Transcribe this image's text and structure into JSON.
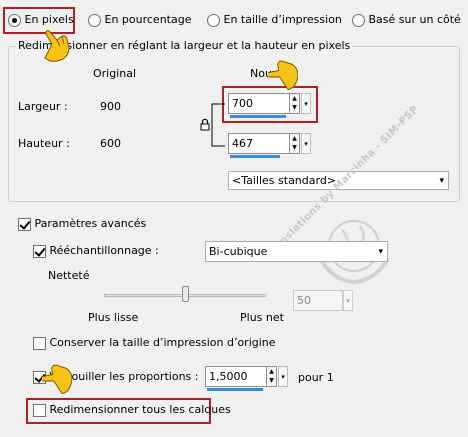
{
  "mode_options": [
    {
      "label": "En pixels",
      "checked": true
    },
    {
      "label": "En pourcentage",
      "checked": false
    },
    {
      "label": "En taille d’impression",
      "checked": false
    },
    {
      "label": "Basé sur un côté",
      "checked": false
    }
  ],
  "group": {
    "title": "Redimensionner en réglant la largeur et la hauteur en pixels",
    "col_original": "Original",
    "col_new": "Nouveau",
    "width_label": "Largeur :",
    "width_original": "900",
    "width_new": "700",
    "height_label": "Hauteur :",
    "height_original": "600",
    "height_new": "467",
    "standard_sizes": "<Tailles standard>"
  },
  "advanced": {
    "label": "Paramètres avancés",
    "checked": true,
    "resample_label": "Rééchantillonnage :",
    "resample_checked": true,
    "resample_value": "Bi-cubique",
    "sharpness_label": "Netteté",
    "sharpness_value": "50",
    "slider_min_label": "Plus lisse",
    "slider_max_label": "Plus net",
    "slider_level": 0.5,
    "keep_print_size_label": "Conserver la taille d’impression d’origine",
    "keep_print_size_checked": false,
    "lock_ratio_label": "Verrouiller les proportions :",
    "lock_ratio_checked": true,
    "ratio_value": "1,5000",
    "ratio_suffix": "pour 1",
    "resize_all_layers_label": "Redimensionner tous les calques",
    "resize_all_layers_checked": false
  },
  "watermark": {
    "text": "Translations by Marcinha - SIM-PSP"
  },
  "colors": {
    "highlight_border": "#b01f24",
    "accent_line": "#3a8be0",
    "hand": "#f7c318"
  },
  "icons": {
    "lock": "lock-icon",
    "pointer": "pointing-hand-icon",
    "spin": "spin-arrows-icon",
    "dropdown": "chevron-down-icon"
  }
}
